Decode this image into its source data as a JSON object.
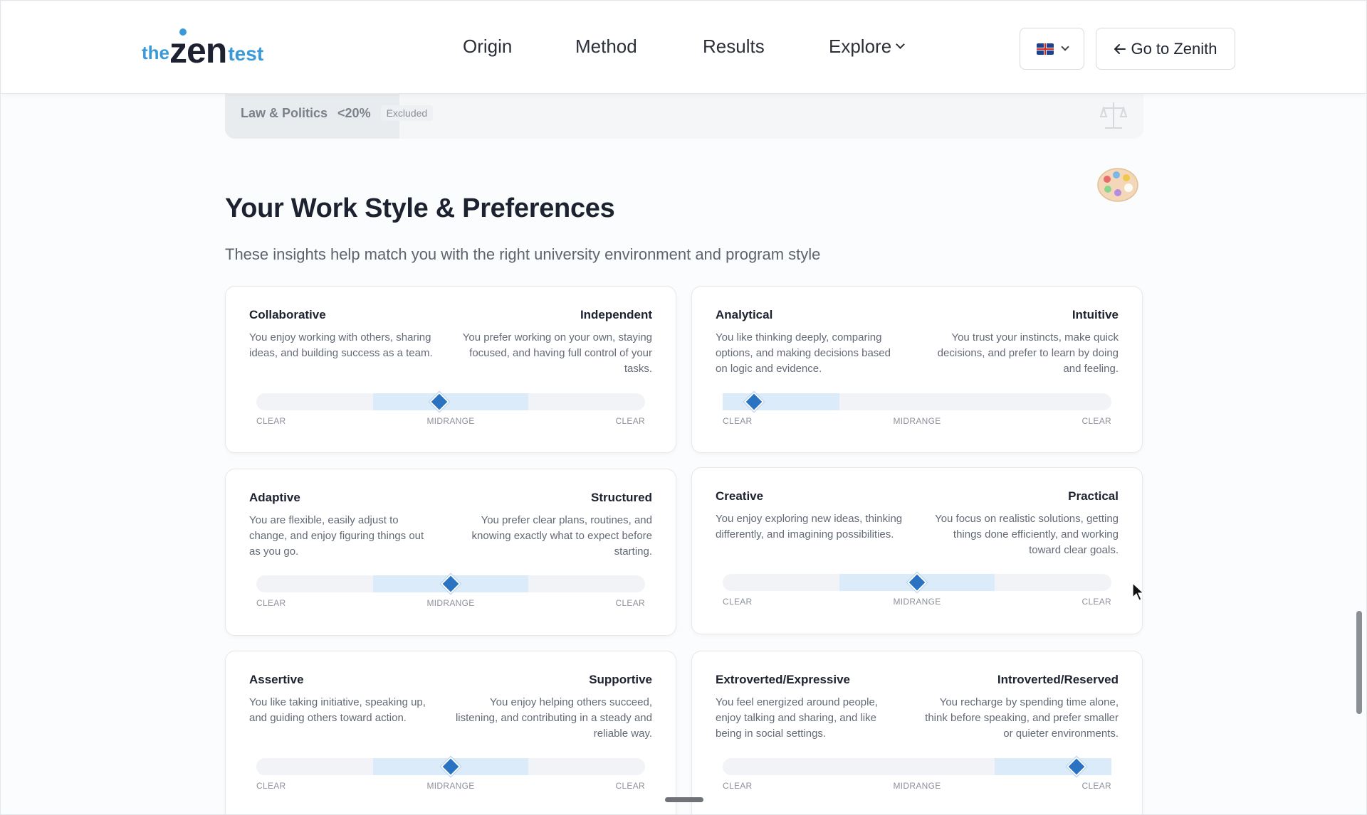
{
  "header": {
    "logo": {
      "the": "the",
      "zen": "zen",
      "test": "test"
    },
    "nav": [
      "Origin",
      "Method",
      "Results",
      "Explore"
    ],
    "language": {
      "flag": "uk-flag-icon"
    },
    "goto_label": "Go to Zenith"
  },
  "excluded_row": {
    "label": "Law & Politics",
    "percent": "<20%",
    "status": "Excluded",
    "icon": "scales-icon"
  },
  "section": {
    "icon": "palette-icon",
    "title": "Your Work Style & Preferences",
    "subtitle": "These insights help match you with the right university environment and program style"
  },
  "scale_labels": {
    "left": "CLEAR",
    "mid": "MIDRANGE",
    "right": "CLEAR"
  },
  "colors": {
    "accent": "#2a72c2",
    "band": "#dcebfa",
    "track": "#f1f3f6"
  },
  "cards": [
    {
      "left_title": "Collaborative",
      "left_desc": "You enjoy working with others, sharing ideas, and building success as a team.",
      "right_title": "Independent",
      "right_desc": "You prefer working on your own, staying focused, and having full control of your tasks.",
      "position": 0.47,
      "band": "midrange"
    },
    {
      "left_title": "Analytical",
      "left_desc": "You like thinking deeply, comparing options, and making decisions based on logic and evidence.",
      "right_title": "Intuitive",
      "right_desc": "You trust your instincts, make quick decisions, and prefer to learn by doing and feeling.",
      "position": 0.08,
      "band": "left"
    },
    {
      "left_title": "Adaptive",
      "left_desc": "You are flexible, easily adjust to change, and enjoy figuring things out as you go.",
      "right_title": "Structured",
      "right_desc": "You prefer clear plans, routines, and knowing exactly what to expect before starting.",
      "position": 0.5,
      "band": "midrange"
    },
    {
      "left_title": "Creative",
      "left_desc": "You enjoy exploring new ideas, thinking differently, and imagining possibilities.",
      "right_title": "Practical",
      "right_desc": "You focus on realistic solutions, getting things done efficiently, and working toward clear goals.",
      "position": 0.5,
      "band": "midrange"
    },
    {
      "left_title": "Assertive",
      "left_desc": "You like taking initiative, speaking up, and guiding others toward action.",
      "right_title": "Supportive",
      "right_desc": "You enjoy helping others succeed, listening, and contributing in a steady and reliable way.",
      "position": 0.5,
      "band": "midrange"
    },
    {
      "left_title": "Extroverted/Expressive",
      "left_desc": "You feel energized around people, enjoy talking and sharing, and like being in social settings.",
      "right_title": "Introverted/Reserved",
      "right_desc": "You recharge by spending time alone, think before speaking, and prefer smaller or quieter environments.",
      "position": 0.91,
      "band": "right"
    }
  ]
}
